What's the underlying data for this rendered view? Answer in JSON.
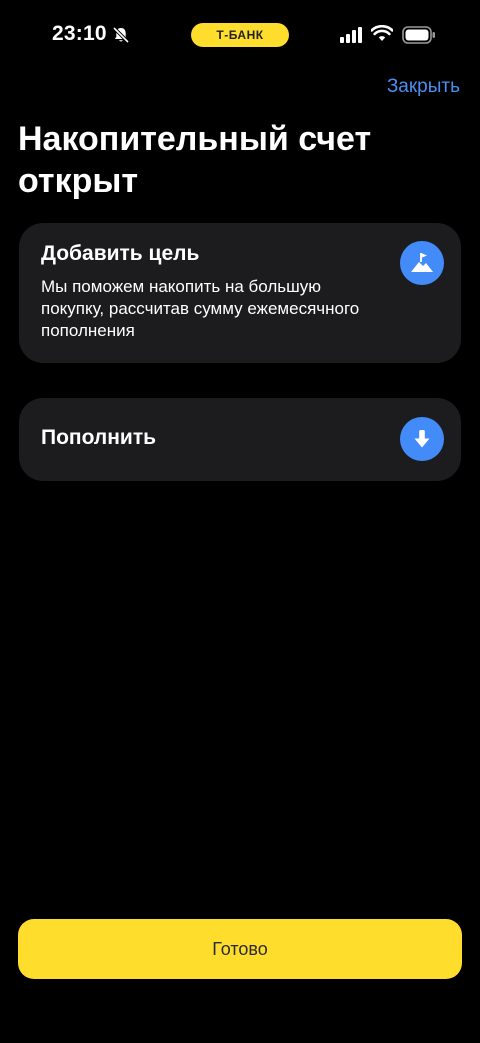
{
  "status_bar": {
    "time": "23:10",
    "bank_label": "Т-БАНК",
    "icons": [
      "bell-off-icon",
      "signal-icon",
      "wifi-icon",
      "battery-icon"
    ]
  },
  "header": {
    "close_label": "Закрыть"
  },
  "title": "Накопительный счет открыт",
  "cards": [
    {
      "title": "Добавить цель",
      "description": "Мы поможем накопить на большую покупку, рассчитав сумму ежемесячного пополнения",
      "icon": "flag-mountain-icon"
    },
    {
      "title": "Пополнить",
      "icon": "arrow-down-icon"
    }
  ],
  "footer": {
    "done_label": "Готово"
  },
  "colors": {
    "background": "#000000",
    "card": "#1c1c1e",
    "accent_yellow": "#ffdd2d",
    "link_blue": "#4a8ff2",
    "icon_blue": "#428bf9"
  }
}
